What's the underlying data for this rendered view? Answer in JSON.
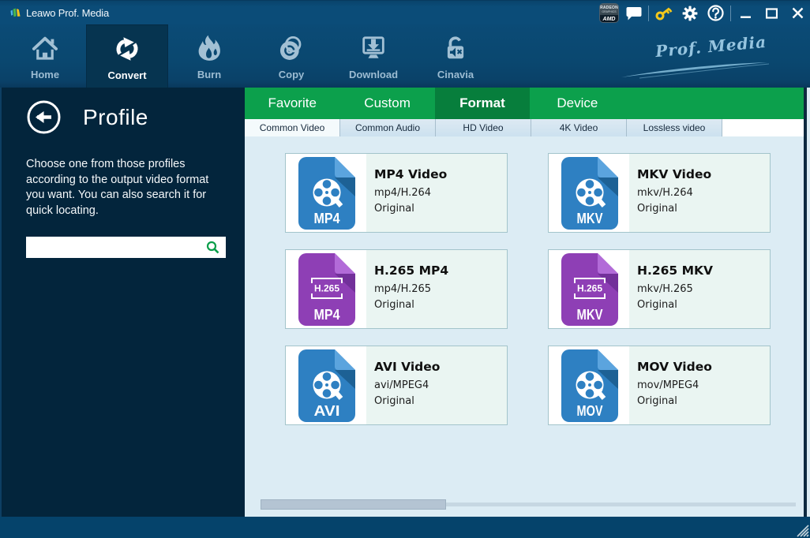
{
  "window": {
    "title": "Leawo Prof. Media"
  },
  "titlebar": {
    "badge": {
      "line1": "RADEON",
      "line2": "GRAPHICS",
      "line3": "AMD"
    },
    "icons": [
      "amd-radeon-badge",
      "message-icon",
      "key-icon",
      "gear-icon",
      "help-icon",
      "minimize-icon",
      "maximize-icon",
      "close-icon"
    ]
  },
  "navbar": {
    "items": [
      {
        "label": "Home",
        "icon": "home-icon",
        "active": false
      },
      {
        "label": "Convert",
        "icon": "convert-icon",
        "active": true
      },
      {
        "label": "Burn",
        "icon": "burn-icon",
        "active": false
      },
      {
        "label": "Copy",
        "icon": "copy-icon",
        "active": false
      },
      {
        "label": "Download",
        "icon": "download-icon",
        "active": false
      },
      {
        "label": "Cinavia",
        "icon": "cinavia-icon",
        "active": false
      }
    ],
    "brand_script": "Prof. Media"
  },
  "sidebar": {
    "title": "Profile",
    "description": "Choose one from those profiles according to the output video format you want. You can also search it for quick locating.",
    "search": {
      "value": "",
      "icon": "search-icon"
    }
  },
  "tabs": [
    {
      "label": "Favorite",
      "active": false
    },
    {
      "label": "Custom",
      "active": false
    },
    {
      "label": "Format",
      "active": true
    },
    {
      "label": "Device",
      "active": false
    }
  ],
  "subtabs": [
    {
      "label": "Common Video",
      "active": true
    },
    {
      "label": "Common Audio",
      "active": false
    },
    {
      "label": "HD Video",
      "active": false
    },
    {
      "label": "4K Video",
      "active": false
    },
    {
      "label": "Lossless video",
      "active": false
    }
  ],
  "profiles": [
    {
      "title": "MP4 Video",
      "format_line": "mp4/H.264",
      "quality": "Original",
      "badge": "MP4",
      "icon": "film-reel-file-icon",
      "color": "blue"
    },
    {
      "title": "MKV Video",
      "format_line": "mkv/H.264",
      "quality": "Original",
      "badge": "MKV",
      "icon": "film-reel-file-icon",
      "color": "blue"
    },
    {
      "title": "H.265 MP4",
      "format_line": "mp4/H.265",
      "quality": "Original",
      "badge": "MP4",
      "frame_label": "H.265",
      "icon": "h265-file-icon",
      "color": "purple"
    },
    {
      "title": "H.265 MKV",
      "format_line": "mkv/H.265",
      "quality": "Original",
      "badge": "MKV",
      "frame_label": "H.265",
      "icon": "h265-file-icon",
      "color": "purple"
    },
    {
      "title": "AVI Video",
      "format_line": "avi/MPEG4",
      "quality": "Original",
      "badge": "AVI",
      "icon": "film-reel-file-icon",
      "color": "blue"
    },
    {
      "title": "MOV Video",
      "format_line": "mov/MPEG4",
      "quality": "Original",
      "badge": "MOV",
      "icon": "film-reel-file-icon",
      "color": "blue"
    }
  ],
  "colors": {
    "green_tab": "#0ca04c",
    "green_tab_active": "#077e3c",
    "blue_icon": "#2e80c2",
    "purple_icon": "#8e3fb5",
    "key_icon_yellow": "#f3c81c"
  }
}
